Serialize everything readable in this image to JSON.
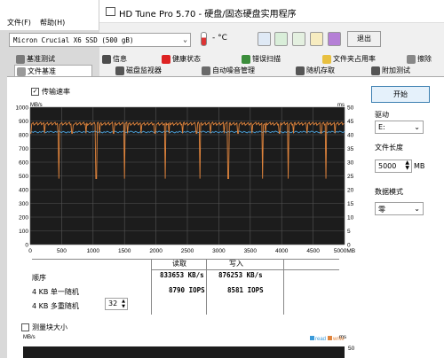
{
  "background_menu": {
    "file": "文件(F)",
    "help": "帮助(H)"
  },
  "window": {
    "title": "HD Tune Pro 5.70 - 硬盘/固态硬盘实用程序"
  },
  "toolbar": {
    "drive": "Micron Crucial X6 SSD (500 gB)",
    "temperature": "- °C",
    "exit": "退出"
  },
  "tabs_row1": [
    "基准测试",
    "信息",
    "健康状态",
    "错误扫描",
    "文件夹占用率",
    "擦除"
  ],
  "tabs_row2": [
    "文件基准",
    "磁盘监视器",
    "自动噪音管理",
    "随机存取",
    "附加测试"
  ],
  "panel": {
    "checkbox_rate": "传输速率",
    "start_button": "开始",
    "drive_label": "驱动",
    "drive_value": "E:",
    "filelen_label": "文件长度",
    "filelen_value": "5000",
    "filelen_unit": "MB",
    "pattern_label": "数据模式",
    "pattern_value": "零",
    "block_checkbox": "测量块大小"
  },
  "results": {
    "col_read": "读取",
    "col_write": "写入",
    "rows": [
      {
        "label": "顺序",
        "read": "833653 KB/s",
        "write": "876253 KB/s"
      },
      {
        "label": "4 KB 单一随机",
        "read": "8790 IOPS",
        "write": "8581 IOPS"
      },
      {
        "label": "4 KB 多重随机",
        "queue": "32",
        "read": "",
        "write": ""
      }
    ]
  },
  "chart_data": {
    "type": "line",
    "left_unit": "MB/s",
    "right_unit": "ms",
    "y_left": [
      0,
      100,
      200,
      300,
      400,
      500,
      600,
      700,
      800,
      900,
      1000
    ],
    "y_right": [
      0,
      5,
      10,
      15,
      20,
      25,
      30,
      35,
      40,
      45,
      50
    ],
    "x_ticks": [
      "0",
      "500",
      "1000",
      "1500",
      "2000",
      "2500",
      "3000",
      "3500",
      "4000",
      "4500",
      "5000MB"
    ],
    "ylim": [
      0,
      1000
    ],
    "xlim": [
      0,
      5000
    ],
    "series": [
      {
        "name": "read",
        "color": "#4a9fd8",
        "base": 820
      },
      {
        "name": "write",
        "color": "#e0843c",
        "base": 880,
        "dips": [
          450,
          1050,
          1500,
          2150,
          2700,
          3150,
          3700,
          4100,
          4700
        ]
      }
    ]
  },
  "chart2": {
    "left_unit": "MB/s",
    "right_unit": "ms",
    "y_top": "50",
    "legend": [
      "read",
      "write"
    ],
    "legend_colors": [
      "#3a9ad9",
      "#e0843c"
    ]
  },
  "colors": {
    "accent": "#3c7fb1",
    "chart_bg": "#1c1c1c",
    "grid": "#555555"
  }
}
